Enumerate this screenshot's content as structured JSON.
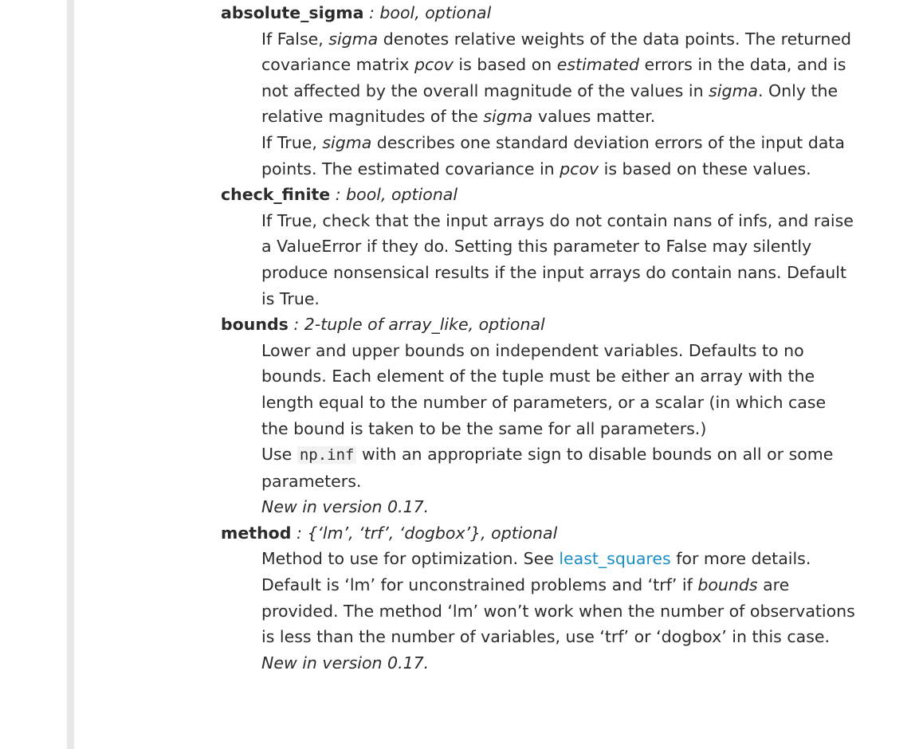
{
  "params": {
    "absolute_sigma": {
      "name": "absolute_sigma",
      "type": " : bool, optional",
      "p1": {
        "t1": "If False, ",
        "e1": "sigma",
        "t2": " denotes relative weights of the data points. The returned covariance matrix ",
        "e2": "pcov",
        "t3": " is based on ",
        "e3": "estimated",
        "t4": " errors in the data, and is not affected by the overall magnitude of the values in ",
        "e4": "sigma",
        "t5": ". Only the relative magnitudes of the ",
        "e5": "sigma",
        "t6": " values matter."
      },
      "p2": {
        "t1": "If True, ",
        "e1": "sigma",
        "t2": " describes one standard deviation errors of the input data points. The estimated covariance in ",
        "e2": "pcov",
        "t3": " is based on these values."
      }
    },
    "check_finite": {
      "name": "check_finite",
      "type": " : bool, optional",
      "p1": "If True, check that the input arrays do not contain nans of infs, and raise a ValueError if they do. Setting this parameter to False may silently produce nonsensical results if the input arrays do contain nans. Default is True."
    },
    "bounds": {
      "name": "bounds",
      "type": " : 2-tuple of array_like, optional",
      "p1": "Lower and upper bounds on independent variables. Defaults to no bounds. Each element of the tuple must be either an array with the length equal to the number of parameters, or a scalar (in which case the bound is taken to be the same for all parameters.)",
      "p2": {
        "t1": "Use ",
        "code": "np.inf",
        "t2": " with an appropriate sign to disable bounds on all or some parameters."
      },
      "version_note": "New in version 0.17."
    },
    "method": {
      "name": "method",
      "type": " : {‘lm’, ‘trf’, ‘dogbox’}, optional",
      "p1": {
        "t1": "Method to use for optimization. See ",
        "link": "least_squares",
        "t2": " for more details. Default is ‘lm’ for unconstrained problems and ‘trf’ if ",
        "e1": "bounds",
        "t3": " are provided. The method ‘lm’ won’t work when the number of observations is less than the number of variables, use ‘trf’ or ‘dogbox’ in this case."
      },
      "version_note": "New in version 0.17."
    }
  }
}
